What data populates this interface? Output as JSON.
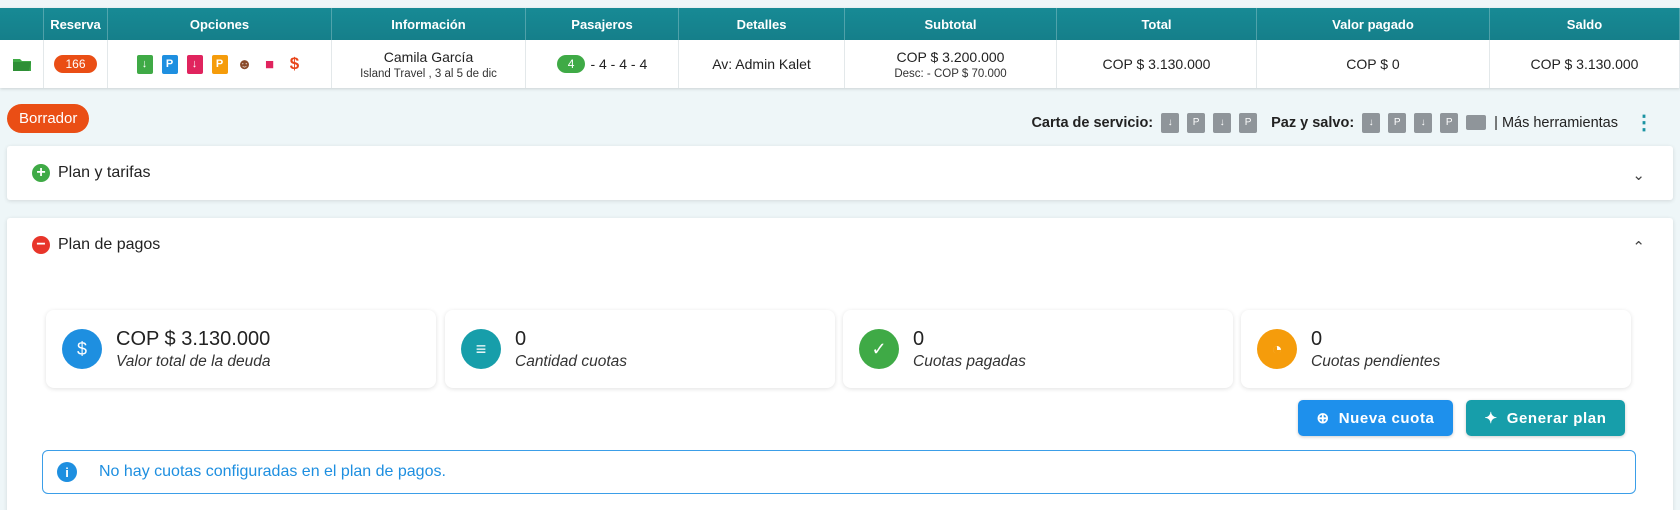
{
  "table": {
    "headers": [
      "Reserva",
      "Opciones",
      "Información",
      "Pasajeros",
      "Detalles",
      "Subtotal",
      "Total",
      "Valor pagado",
      "Saldo"
    ],
    "row": {
      "reserva": "166",
      "cliente": "Camila García",
      "info_sub": "Island Travel , 3 al 5 de dic",
      "pasajeros_badge": "4",
      "pasajeros_rest": "- 4 - 4 - 4",
      "detalles": "Av: Admin Kalet",
      "subtotal": "COP $ 3.200.000",
      "descuento": "Desc: - COP $ 70.000",
      "total": "COP $ 3.130.000",
      "valor_pagado": "COP $ 0",
      "saldo": "COP $ 3.130.000"
    },
    "option_icons": [
      "download-icon",
      "pdf-icon",
      "download-pink-icon",
      "pdf-orange-icon",
      "passengers-icon",
      "car-icon",
      "dollar-icon"
    ]
  },
  "toolbar": {
    "status": "Borrador",
    "carta_label": "Carta de servicio:",
    "paz_label": "Paz y salvo:",
    "mas": "| Más herramientas"
  },
  "panels": {
    "plan_tarifas": "Plan y tarifas",
    "plan_pagos": "Plan de pagos"
  },
  "stats": [
    {
      "value": "COP $ 3.130.000",
      "label": "Valor total de la deuda",
      "icon": "money-clock-icon",
      "color": "#1e8fe0"
    },
    {
      "value": "0",
      "label": "Cantidad cuotas",
      "icon": "list-icon",
      "color": "#179eaa"
    },
    {
      "value": "0",
      "label": "Cuotas pagadas",
      "icon": "check-icon",
      "color": "#3faa46"
    },
    {
      "value": "0",
      "label": "Cuotas pendientes",
      "icon": "pending-clock-icon",
      "color": "#f59c0b"
    }
  ],
  "buttons": {
    "nueva_cuota": "Nueva cuota",
    "generar_plan": "Generar plan"
  },
  "alert": "No hay cuotas configuradas en el plan de pagos."
}
